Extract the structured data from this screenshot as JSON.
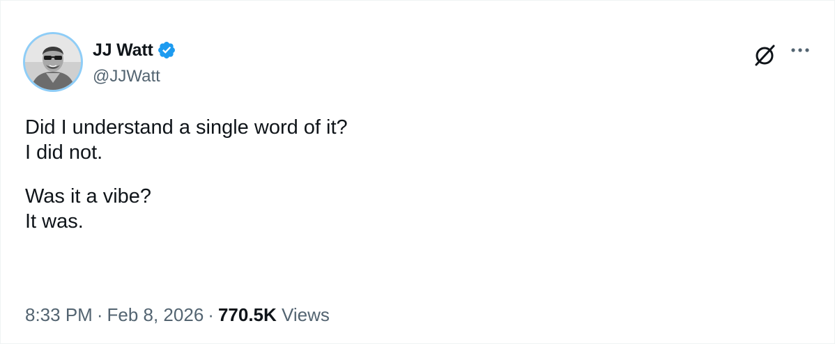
{
  "author": {
    "display_name": "JJ Watt",
    "handle": "@JJWatt",
    "verified_icon": "verified-badge-icon",
    "avatar_icon": "profile-photo"
  },
  "actions": {
    "grok_icon": "grok-icon",
    "more_icon": "more-options-icon"
  },
  "tweet": {
    "lines": [
      "Did I understand a single word of it?",
      "I did not.",
      "",
      "Was it a vibe?",
      "It was."
    ]
  },
  "meta": {
    "time": "8:33 PM",
    "separator": "·",
    "date": "Feb 8, 2026",
    "views_count": "770.5K",
    "views_label": "Views"
  },
  "colors": {
    "text": "#0f1419",
    "muted": "#536471",
    "verified": "#1d9bf0",
    "avatar_ring": "#8ecdf7"
  }
}
